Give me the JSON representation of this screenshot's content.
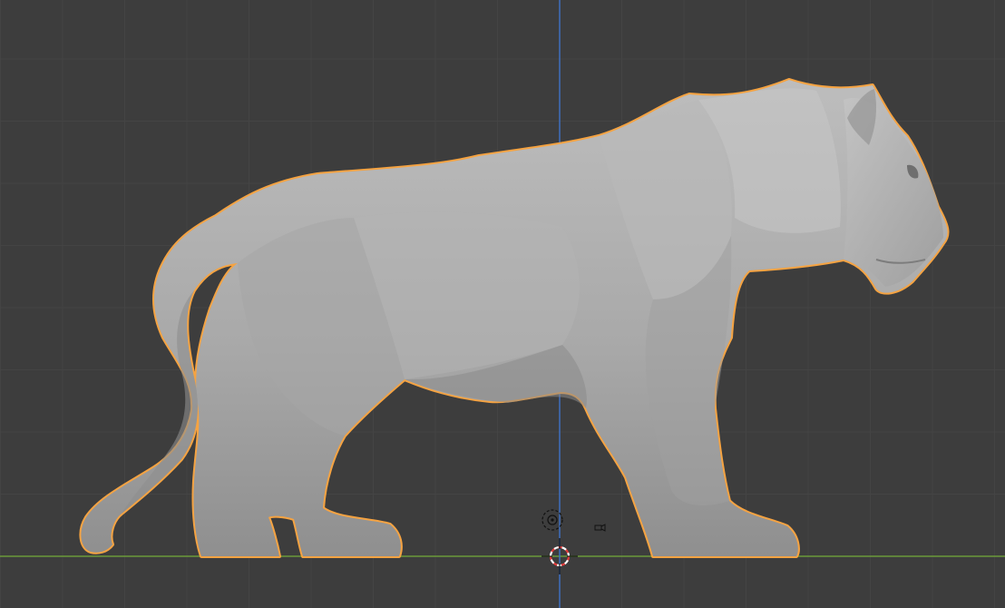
{
  "viewport": {
    "background": "#3d3d3d",
    "grid_minor_color": "#444444",
    "grid_major_color": "#4a4a4a",
    "x_axis_color": "#6b9a39",
    "y_axis_color": "#3f6fbf",
    "selection_outline_color": "#f5a342",
    "mesh_color": "#a8a8a8"
  },
  "scene": {
    "object_icon": "big-cat-sculpt-mesh",
    "selected": true,
    "cursor_icon": "3d-cursor-icon",
    "light_icon": "light-icon",
    "camera_icon": "camera-icon"
  }
}
